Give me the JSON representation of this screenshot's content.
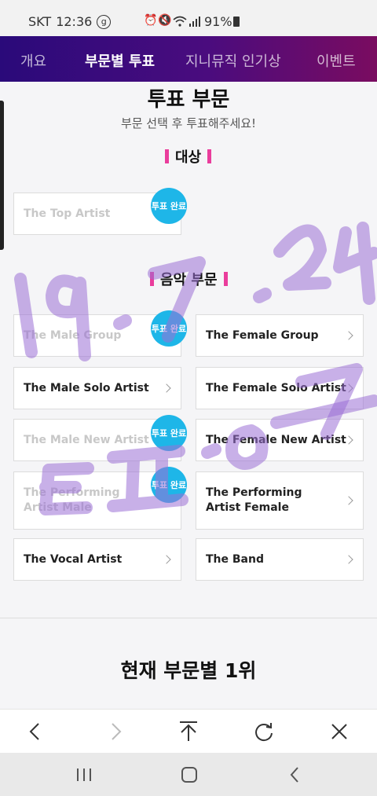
{
  "status_bar": {
    "carrier": "SKT",
    "time": "12:36",
    "app_icon": "g-icon",
    "battery": "91%"
  },
  "tabs": [
    {
      "label": "개요"
    },
    {
      "label": "부문별 투표"
    },
    {
      "label": "지니뮤직 인기상"
    },
    {
      "label": "이벤트"
    }
  ],
  "vote": {
    "title": "투표 부문",
    "subtitle": "부문 선택 후 투표해주세요!",
    "grand_prize": {
      "label": "대상",
      "items": [
        {
          "name": "The Top Artist",
          "done": true
        }
      ]
    },
    "music": {
      "label": "음악 부문",
      "items": [
        {
          "name": "The Male Group",
          "done": true
        },
        {
          "name": "The Female Group",
          "done": false
        },
        {
          "name": "The Male Solo Artist",
          "done": false
        },
        {
          "name": "The Female Solo Artist",
          "done": false
        },
        {
          "name": "The Male New Artist",
          "done": true
        },
        {
          "name": "The Female New Artist",
          "done": false
        },
        {
          "name": "The Performing Artist Male",
          "done": true
        },
        {
          "name": "The Performing Artist Female",
          "done": false
        },
        {
          "name": "The Vocal Artist",
          "done": false
        },
        {
          "name": "The Band",
          "done": false
        }
      ]
    },
    "done_badge": "투표 완료"
  },
  "ranking": {
    "title": "현재 부문별 1위"
  },
  "watermark_text": "19.7.24 E·o·7",
  "colors": {
    "accent": "#ea3d9c",
    "badge": "#1eb6e8",
    "tab_gradient_start": "#2a0a7a",
    "tab_gradient_end": "#7a0c60",
    "watermark": "#9b6fd6"
  }
}
